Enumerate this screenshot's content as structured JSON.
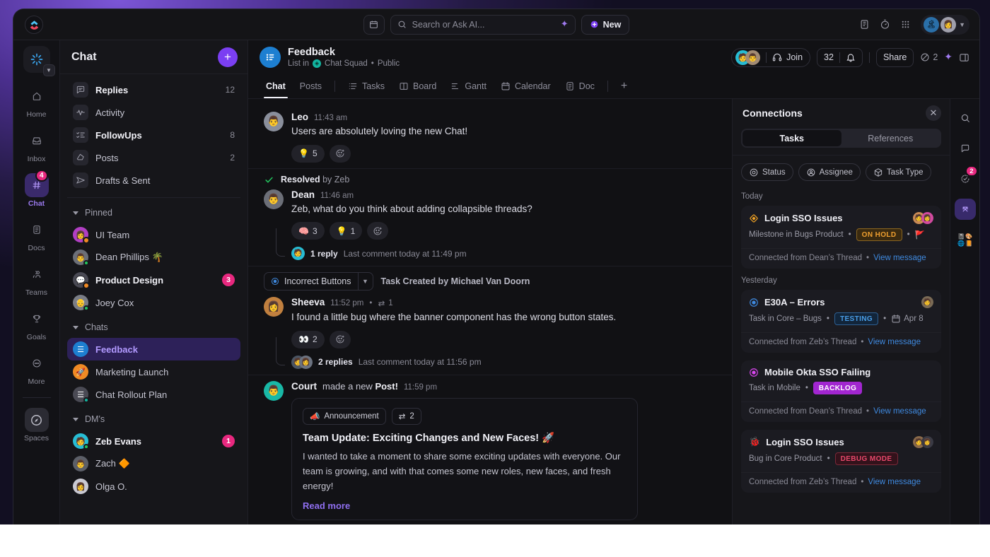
{
  "topbar": {
    "calendar_icon": "calendar-icon",
    "search_placeholder": "Search or Ask AI...",
    "ai_icon": "sparkle-icon",
    "new_label": "New",
    "icons": [
      "clipboard-icon",
      "stopwatch-icon",
      "apps-grid-icon"
    ]
  },
  "rail": {
    "logo": "clickup-logo",
    "items": [
      {
        "label": "Home",
        "icon": "home-icon",
        "badge": ""
      },
      {
        "label": "Inbox",
        "icon": "inbox-icon",
        "badge": ""
      },
      {
        "label": "Chat",
        "icon": "hash-icon",
        "badge": "4"
      },
      {
        "label": "Docs",
        "icon": "doc-icon",
        "badge": ""
      },
      {
        "label": "Teams",
        "icon": "teams-icon",
        "badge": ""
      },
      {
        "label": "Goals",
        "icon": "trophy-icon",
        "badge": ""
      },
      {
        "label": "More",
        "icon": "ellipsis-icon",
        "badge": ""
      }
    ],
    "spaces_label": "Spaces"
  },
  "sidebar": {
    "title": "Chat",
    "add_label": "+",
    "nav": [
      {
        "label": "Replies",
        "count": "12",
        "icon": "reply-bubble-icon",
        "bold": true
      },
      {
        "label": "Activity",
        "count": "",
        "icon": "activity-pulse-icon",
        "bold": false
      },
      {
        "label": "FollowUps",
        "count": "8",
        "icon": "checklist-icon",
        "bold": true
      },
      {
        "label": "Posts",
        "count": "2",
        "icon": "post-icon",
        "bold": false
      },
      {
        "label": "Drafts & Sent",
        "count": "",
        "icon": "send-icon",
        "bold": false
      }
    ],
    "groups": [
      {
        "label": "Pinned",
        "items": [
          {
            "label": "UI Team",
            "badge": "",
            "bold": false,
            "color": "#b13fc4",
            "glyph": "👩",
            "dot": "",
            "pin": true
          },
          {
            "label": "Dean Phillips 🌴",
            "badge": "",
            "bold": false,
            "color": "#6c6f78",
            "glyph": "👨",
            "dot": "#22c55e",
            "pin": false
          },
          {
            "label": "Product Design",
            "badge": "3",
            "bold": true,
            "color": "#4a4a54",
            "glyph": "💬",
            "dot": "",
            "pin": true
          },
          {
            "label": "Joey Cox",
            "badge": "",
            "bold": false,
            "color": "#7a7d86",
            "glyph": "👴",
            "dot": "#22c55e",
            "pin": false
          }
        ]
      },
      {
        "label": "Chats",
        "items": [
          {
            "label": "Feedback",
            "badge": "",
            "bold": false,
            "color": "#1d7fd1",
            "glyph": "☰",
            "dot": "",
            "selected": true
          },
          {
            "label": "Marketing Launch",
            "badge": "",
            "bold": false,
            "color": "#f08a24",
            "glyph": "🚀",
            "dot": ""
          },
          {
            "label": "Chat Rollout Plan",
            "badge": "",
            "bold": false,
            "color": "#4a4a54",
            "glyph": "☰",
            "dot": "#12b5a0"
          }
        ]
      },
      {
        "label": "DM's",
        "items": [
          {
            "label": "Zeb Evans",
            "badge": "1",
            "bold": true,
            "color": "#27bdd4",
            "glyph": "🧑",
            "dot": "#22c55e"
          },
          {
            "label": "Zach 🔶",
            "badge": "",
            "bold": false,
            "color": "#5c5f68",
            "glyph": "👨",
            "dot": ""
          },
          {
            "label": "Olga O.",
            "badge": "",
            "bold": false,
            "color": "#c9c9d2",
            "glyph": "👩",
            "dot": ""
          }
        ]
      }
    ]
  },
  "channel": {
    "name": "Feedback",
    "subtitle_prefix": "List in",
    "space": "Chat Squad",
    "visibility": "Public",
    "members_label": "",
    "join_label": "Join",
    "member_count": "32",
    "bell_icon": "bell-icon",
    "share_label": "Share",
    "link_count": "2",
    "ai_icon": "sparkle-icon",
    "panel_icon": "panel-toggle-icon",
    "tabs": [
      {
        "label": "Chat",
        "icon": "",
        "active": true
      },
      {
        "label": "Posts",
        "icon": "",
        "active": false
      },
      {
        "label": "Tasks",
        "icon": "list-icon",
        "active": false
      },
      {
        "label": "Board",
        "icon": "board-icon",
        "active": false
      },
      {
        "label": "Gantt",
        "icon": "gantt-icon",
        "active": false
      },
      {
        "label": "Calendar",
        "icon": "calendar-icon",
        "active": false
      },
      {
        "label": "Doc",
        "icon": "doc-icon",
        "active": false
      }
    ],
    "add_tab": "+"
  },
  "messages": [
    {
      "type": "message",
      "author": "Leo",
      "time": "11:43 am",
      "avatar_color": "#8a8f9c",
      "avatar_glyph": "👨",
      "text": "Users are absolutely loving the new Chat!",
      "reactions": [
        {
          "emoji": "💡",
          "count": "5"
        }
      ],
      "add_reaction_icon": "add-reaction-icon"
    },
    {
      "type": "message",
      "resolved_label": "Resolved",
      "resolved_by": "by Zeb",
      "author": "Dean",
      "time": "11:46 am",
      "avatar_color": "#6c6f78",
      "avatar_glyph": "👨",
      "text": "Zeb, what do you think about adding collapsible threads?",
      "reactions": [
        {
          "emoji": "🧠",
          "count": "3"
        },
        {
          "emoji": "💡",
          "count": "1"
        }
      ],
      "add_reaction_icon": "add-reaction-icon",
      "thread_count": "1 reply",
      "thread_meta": "Last comment today at 11:49 pm",
      "thread_avatars": [
        "#27bdd4"
      ]
    },
    {
      "type": "message",
      "task_chip": "Incorrect Buttons",
      "task_note": "Task Created by Michael Van Doorn",
      "author": "Sheeva",
      "time": "11:52 pm",
      "edit_count": "1",
      "avatar_color": "#c1803f",
      "avatar_glyph": "👩",
      "text": "I found a little bug where the banner component has the wrong button states.",
      "reactions": [
        {
          "emoji": "👀",
          "count": "2"
        }
      ],
      "add_reaction_icon": "add-reaction-icon",
      "thread_count": "2 replies",
      "thread_meta": "Last comment today at 11:56 pm",
      "thread_avatars": [
        "#4b5563",
        "#6b7280"
      ]
    },
    {
      "type": "post",
      "author": "Court",
      "action": "made a new",
      "action_bold": "Post!",
      "time": "11:59 pm",
      "avatar_color": "#19b8a6",
      "avatar_glyph": "👨",
      "chips": [
        {
          "emoji": "📣",
          "label": "Announcement"
        },
        {
          "emoji": "⇄",
          "label": "2"
        }
      ],
      "title": "Team Update: Exciting Changes and New Faces! 🚀",
      "body": "I wanted to take a moment to share some exciting updates with everyone. Our team is growing, and with that comes some new roles, new faces, and fresh energy!",
      "read_more": "Read more"
    }
  ],
  "connections": {
    "title": "Connections",
    "close_icon": "close-icon",
    "tabs": [
      {
        "label": "Tasks",
        "active": true
      },
      {
        "label": "References",
        "active": false
      }
    ],
    "filters": [
      {
        "label": "Status",
        "icon": "target-icon"
      },
      {
        "label": "Assignee",
        "icon": "person-circle-icon"
      },
      {
        "label": "Task Type",
        "icon": "cube-icon"
      }
    ],
    "groups": [
      {
        "day": "Today",
        "cards": [
          {
            "icon": "milestone-diamond-icon",
            "icon_color": "#f5a524",
            "name": "Login SSO Issues",
            "meta": "Milestone in Bugs Product",
            "status": "ON HOLD",
            "status_color": "#f0a030",
            "status_bg": "#3a2a10",
            "status_border": "#8a6520",
            "extra_icon": "flag-icon",
            "due": "",
            "avatars": [
              "#c98a55",
              "#d24aa0"
            ],
            "footer": "Connected from Dean’s Thread",
            "footer_link": "View message"
          }
        ]
      },
      {
        "day": "Yesterday",
        "cards": [
          {
            "icon": "task-circle-icon",
            "icon_color": "#3f8ae0",
            "name": "E30A – Errors",
            "meta": "Task in Core – Bugs",
            "status": "TESTING",
            "status_color": "#4a9ee8",
            "status_bg": "#12253a",
            "status_border": "#2d5f92",
            "extra_icon": "calendar-icon",
            "due": "Apr 8",
            "avatars": [
              "#7a6a55"
            ],
            "footer": "Connected from Zeb’s Thread",
            "footer_link": "View message"
          },
          {
            "icon": "task-circle-icon",
            "icon_color": "#d946ef",
            "name": "Mobile Okta SSO Failing",
            "meta": "Task in Mobile",
            "status": "BACKLOG",
            "status_color": "#ffffff",
            "status_bg": "#a226d0",
            "status_border": "#a226d0",
            "extra_icon": "",
            "due": "",
            "avatars": [],
            "footer": "Connected from Dean’s Thread",
            "footer_link": "View message"
          },
          {
            "icon": "bug-icon",
            "icon_color": "#e8486b",
            "name": "Login SSO Issues",
            "meta": "Bug in Core Product",
            "status": "DEBUG MODE",
            "status_color": "#e8486b",
            "status_bg": "#33121b",
            "status_border": "#7a2838",
            "extra_icon": "",
            "due": "",
            "avatars": [
              "#8a6a4a",
              "#3a3a44"
            ],
            "footer": "Connected from Zeb’s Thread",
            "footer_link": "View message"
          }
        ]
      }
    ]
  },
  "right_rail": [
    {
      "icon": "search-icon",
      "badge": "",
      "active": false
    },
    {
      "icon": "comment-icon",
      "badge": "",
      "active": false
    },
    {
      "icon": "check-circle-icon",
      "badge": "2",
      "active": false
    },
    {
      "icon": "connections-icon",
      "badge": "",
      "active": true
    },
    {
      "icon": "apps-icon",
      "badge": "",
      "active": false
    }
  ],
  "colors": {
    "accent": "#7b3ff2",
    "badge": "#e8287f",
    "link": "#3f8ae0",
    "selected_bg": "#2d2159"
  }
}
